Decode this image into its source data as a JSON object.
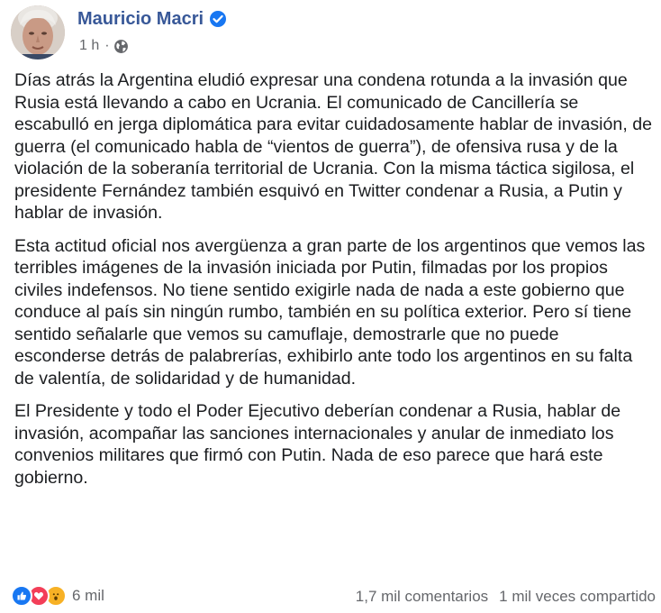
{
  "post": {
    "author": "Mauricio Macri",
    "time": "1 h",
    "meta_separator": "·",
    "paragraphs": [
      "Días atrás la Argentina eludió expresar una condena rotunda a la invasión que Rusia está llevando a cabo en Ucrania. El comunicado de Cancillería se escabulló en jerga diplomática para evitar cuidadosamente hablar de invasión, de guerra (el comunicado habla de “vientos de guerra”), de ofensiva rusa y de la violación de la soberanía territorial de Ucrania. Con la misma táctica sigilosa, el presidente Fernández también esquivó en Twitter condenar a Rusia, a Putin y hablar de invasión.",
      "Esta actitud oficial nos avergüenza a gran parte de los argentinos que vemos las terribles imágenes de la invasión iniciada por Putin, filmadas por los propios civiles indefensos. No tiene sentido exigirle nada de nada a este gobierno que conduce al país sin ningún rumbo, también en su política exterior. Pero sí tiene sentido señalarle que vemos su camuflaje, demostrarle que no puede esconderse detrás de palabrerías, exhibirlo ante todo los argentinos en su falta de valentía, de solidaridad y de humanidad.",
      "El Presidente y todo el Poder Ejecutivo deberían condenar a Rusia, hablar de invasión, acompañar las sanciones internacionales y anular de inmediato los convenios militares que firmó con Putin. Nada de eso parece que hará este gobierno."
    ]
  },
  "footer": {
    "reactions_count": "6 mil",
    "comments": "1,7 mil comentarios",
    "shares": "1 mil veces compartido"
  },
  "icons": {
    "verified": "verified-badge-icon",
    "privacy": "globe-icon",
    "reactions": [
      "like-icon",
      "love-icon",
      "wow-icon"
    ]
  },
  "colors": {
    "author": "#385898",
    "verified": "#1877f2",
    "like": "#1877f2",
    "love": "#f33e58",
    "wow": "#f7b125",
    "secondary_text": "#65676b"
  }
}
